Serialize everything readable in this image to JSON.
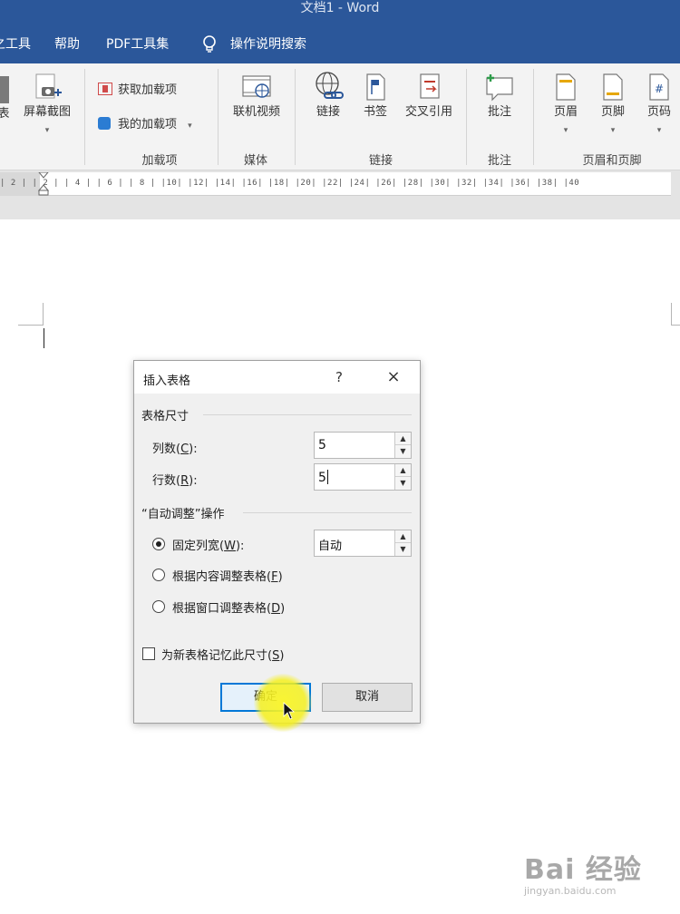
{
  "window": {
    "title": "文档1 - Word"
  },
  "menu": {
    "items": [
      "之工具",
      "帮助",
      "PDF工具集"
    ],
    "tell_me": "操作说明搜索"
  },
  "ribbon": {
    "groups": [
      {
        "label": "",
        "buttons": [
          "表",
          "屏幕截图"
        ]
      },
      {
        "label": "加载项",
        "buttons": [
          "获取加载项",
          "我的加载项"
        ]
      },
      {
        "label": "媒体",
        "buttons": [
          "联机视频"
        ]
      },
      {
        "label": "链接",
        "buttons": [
          "链接",
          "书签",
          "交叉引用"
        ]
      },
      {
        "label": "批注",
        "buttons": [
          "批注"
        ]
      },
      {
        "label": "页眉和页脚",
        "buttons": [
          "页眉",
          "页脚",
          "页码"
        ]
      }
    ]
  },
  "ruler": {
    "ticks": "| 2 |  | 2 |  | 4 |  | 6 |  | 8 |  |10|  |12|  |14|  |16|  |18|  |20|  |22|  |24|  |26|  |28|  |30|  |32|  |34|  |36|  |38|  |40"
  },
  "dialog": {
    "title": "插入表格",
    "help": "?",
    "close": "×",
    "table_size_label": "表格尺寸",
    "columns_label": "列数(",
    "columns_key": "C",
    "columns_suffix": "):",
    "columns_value": "5",
    "rows_label": "行数(",
    "rows_key": "R",
    "rows_suffix": "):",
    "rows_value": "5",
    "autofit_label": "“自动调整”操作",
    "fixed_width_label": "固定列宽(",
    "fixed_width_key": "W",
    "fixed_width_suffix": "):",
    "fixed_width_value": "自动",
    "autofit_content_label": "根据内容调整表格(",
    "autofit_content_key": "F",
    "autofit_content_suffix": ")",
    "autofit_window_label": "根据窗口调整表格(",
    "autofit_window_key": "D",
    "autofit_window_suffix": ")",
    "remember_label": "为新表格记忆此尺寸(",
    "remember_key": "S",
    "remember_suffix": ")",
    "ok": "确定",
    "cancel": "取消"
  },
  "watermark": {
    "main": "Bai 经验",
    "sub": "jingyan.baidu.com"
  },
  "colors": {
    "accent": "#2b579a",
    "ok_border": "#0078d7",
    "highlight": "#f5f01e"
  }
}
